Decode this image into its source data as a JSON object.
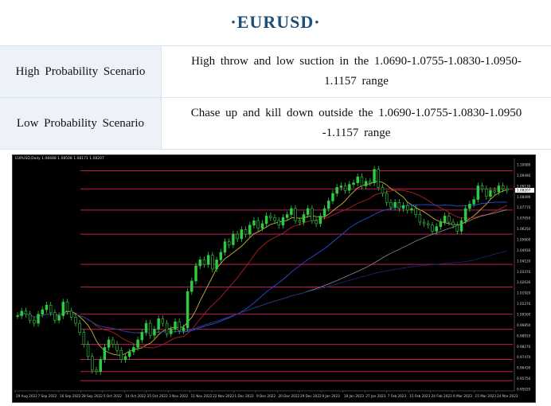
{
  "page": {
    "title": "·EURUSD·"
  },
  "scenarios": [
    {
      "label": "High Probability Scenario",
      "line1": "High throw and low suction in the 1.0690-1.0755-1.0830-1.0950-",
      "line2": "1.1157 range"
    },
    {
      "label": "Low Probability Scenario",
      "line1": "Chase up and kill down outside the 1.0690-1.0755-1.0830-1.0950",
      "line2": "-1.1157 range"
    }
  ],
  "chart_data": {
    "type": "candlestick",
    "symbol_header": "EURUSD,Daily  1.08488 1.08508 1.08171 1.08207",
    "x_tick_labels": [
      "29 Aug 2022",
      "7 Sep 2022",
      "16 Sep 2022",
      "28 Sep 2022",
      "5 Oct 2022",
      "14 Oct 2022",
      "25 Oct 2022",
      "3 Nov 2022",
      "11 Nov 2022",
      "22 Nov 2022",
      "1 Dec 2022",
      "9 Dec 2022",
      "20 Dec 2022",
      "29 Dec 2022",
      "9 Jan 2023",
      "18 Jan 2023",
      "27 Jan 2023",
      "7 Feb 2023",
      "15 Feb 2023",
      "24 Feb 2023",
      "6 Mar 2023",
      "15 Mar 2023",
      "24 Mar 2023"
    ],
    "y_tick_labels": [
      "1.10080",
      "1.09490",
      "1.09130",
      "1.08490",
      "1.07770",
      "1.07050",
      "1.06250",
      "1.05600",
      "1.04930",
      "1.04120",
      "1.03370",
      "1.02630",
      "1.01920",
      "1.01270",
      "1.00500",
      "0.99850",
      "0.98910",
      "0.98270",
      "0.97470",
      "0.96430",
      "0.95750",
      "0.95020"
    ],
    "ylim": [
      0.9492,
      1.1032
    ],
    "horizontal_levels": [
      1.095,
      1.083,
      1.069,
      1.053,
      1.033,
      1.018,
      1.0,
      0.99,
      0.98,
      0.97,
      0.962,
      0.956
    ],
    "colors": {
      "background": "#000000",
      "candle": "#2ecc40",
      "level_line": "#c2185b",
      "ma_yellow": "#c9b03a",
      "ma_red": "#b02020",
      "ma_blue": "#2a4fd8",
      "ma_grey": "#8a8a8a",
      "ma_darkblue": "#1a2a80",
      "axis_text": "#cfcfcf",
      "price_box": "#ffffff"
    },
    "last_price": "1.08207",
    "closes": [
      0.999,
      1.002,
      1.0,
      0.996,
      0.994,
      1.0,
      1.003,
      1.006,
      1.001,
      0.996,
      0.999,
      1.008,
      1.002,
      0.998,
      0.994,
      0.988,
      0.98,
      0.972,
      0.963,
      0.962,
      0.97,
      0.978,
      0.983,
      0.98,
      0.976,
      0.97,
      0.972,
      0.975,
      0.978,
      0.983,
      0.988,
      0.994,
      0.986,
      0.99,
      0.997,
      0.994,
      0.987,
      0.99,
      0.995,
      0.989,
      0.991,
      1.015,
      1.022,
      1.032,
      1.036,
      1.033,
      1.039,
      1.03,
      1.036,
      1.041,
      1.048,
      1.046,
      1.053,
      1.05,
      1.056,
      1.053,
      1.059,
      1.062,
      1.057,
      1.06,
      1.065,
      1.064,
      1.062,
      1.059,
      1.064,
      1.066,
      1.07,
      1.062,
      1.061,
      1.066,
      1.07,
      1.062,
      1.06,
      1.065,
      1.07,
      1.075,
      1.08,
      1.084,
      1.085,
      1.082,
      1.086,
      1.087,
      1.091,
      1.085,
      1.088,
      1.087,
      1.096,
      1.084,
      1.08,
      1.074,
      1.071,
      1.074,
      1.07,
      1.072,
      1.069,
      1.07,
      1.066,
      1.061,
      1.06,
      1.059,
      1.055,
      1.058,
      1.061,
      1.065,
      1.061,
      1.059,
      1.055,
      1.062,
      1.07,
      1.073,
      1.076,
      1.085,
      1.083,
      1.078,
      1.082,
      1.081,
      1.085,
      1.083,
      1.0821
    ]
  }
}
